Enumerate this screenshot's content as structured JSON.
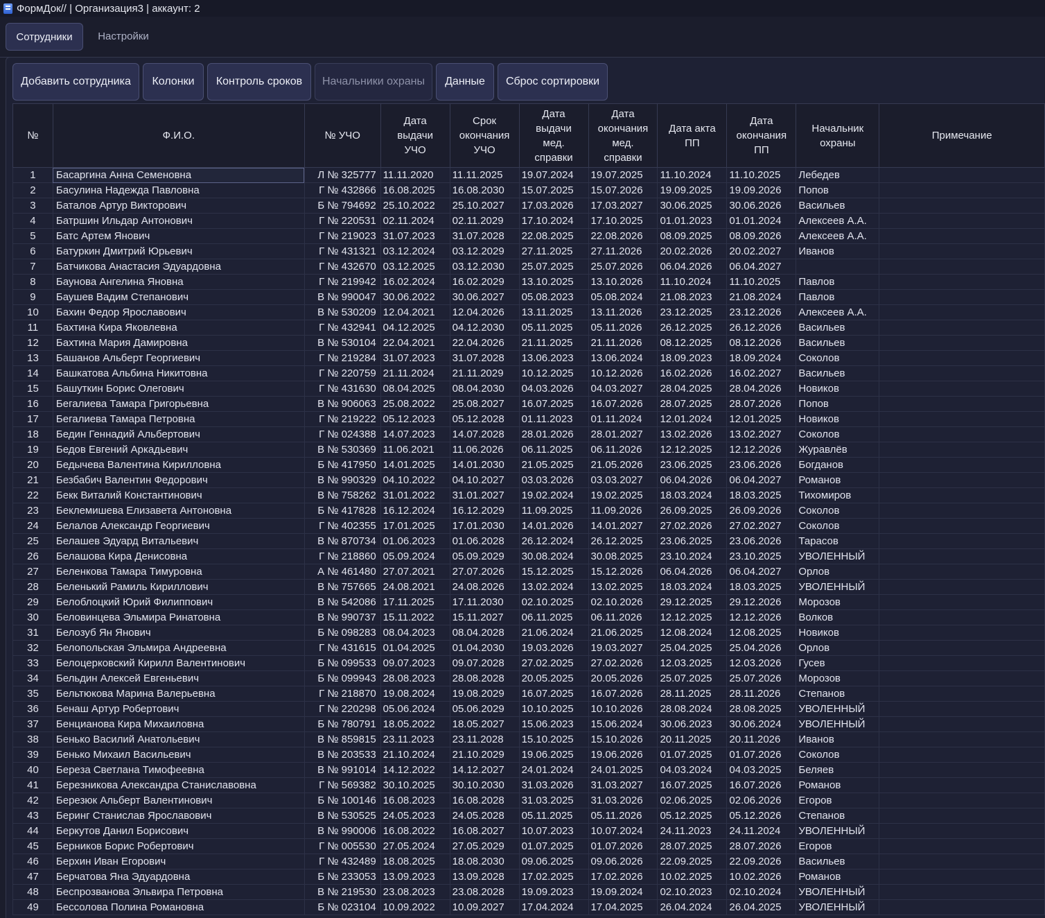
{
  "window": {
    "title": "ФормДок// | Организация3 | аккаунт: 2"
  },
  "tabs": [
    {
      "label": "Сотрудники",
      "active": true
    },
    {
      "label": "Настройки",
      "active": false
    }
  ],
  "toolbar": {
    "add_employee": "Добавить сотрудника",
    "columns": "Колонки",
    "deadline_control": "Контроль сроков",
    "security_chiefs": "Начальники охраны",
    "data": "Данные",
    "reset_sort": "Сброс сортировки"
  },
  "table": {
    "headers": [
      "№",
      "Ф.И.О.",
      "№ УЧО",
      "Дата выдачи УЧО",
      "Срок окончания УЧО",
      "Дата выдачи мед. справки",
      "Дата окончания мед. справки",
      "Дата акта ПП",
      "Дата окончания ПП",
      "Начальник охраны",
      "Примечание"
    ],
    "rows": [
      [
        "1",
        "Басаргина Анна Семеновна",
        "Л № 325777",
        "11.11.2020",
        "11.11.2025",
        "19.07.2024",
        "19.07.2025",
        "11.10.2024",
        "11.10.2025",
        "Лебедев",
        ""
      ],
      [
        "2",
        "Басулина Надежда Павловна",
        "Г № 432866",
        "16.08.2025",
        "16.08.2030",
        "15.07.2025",
        "15.07.2026",
        "19.09.2025",
        "19.09.2026",
        "Попов",
        ""
      ],
      [
        "3",
        "Баталов Артур Викторович",
        "Б № 794692",
        "25.10.2022",
        "25.10.2027",
        "17.03.2026",
        "17.03.2027",
        "30.06.2025",
        "30.06.2026",
        "Васильев",
        ""
      ],
      [
        "4",
        "Батршин Ильдар Антонович",
        "Г № 220531",
        "02.11.2024",
        "02.11.2029",
        "17.10.2024",
        "17.10.2025",
        "01.01.2023",
        "01.01.2024",
        "Алексеев А.А.",
        ""
      ],
      [
        "5",
        "Батс Артем Янович",
        "Г № 219023",
        "31.07.2023",
        "31.07.2028",
        "22.08.2025",
        "22.08.2026",
        "08.09.2025",
        "08.09.2026",
        "Алексеев А.А.",
        ""
      ],
      [
        "6",
        "Батуркин Дмитрий Юрьевич",
        "Г № 431321",
        "03.12.2024",
        "03.12.2029",
        "27.11.2025",
        "27.11.2026",
        "20.02.2026",
        "20.02.2027",
        "Иванов",
        ""
      ],
      [
        "7",
        "Батчикова Анастасия Эдуардовна",
        "Г № 432670",
        "03.12.2025",
        "03.12.2030",
        "25.07.2025",
        "25.07.2026",
        "06.04.2026",
        "06.04.2027",
        "",
        ""
      ],
      [
        "8",
        "Баунова Ангелина Яновна",
        "Г № 219942",
        "16.02.2024",
        "16.02.2029",
        "13.10.2025",
        "13.10.2026",
        "11.10.2024",
        "11.10.2025",
        "Павлов",
        ""
      ],
      [
        "9",
        "Баушев Вадим Степанович",
        "В № 990047",
        "30.06.2022",
        "30.06.2027",
        "05.08.2023",
        "05.08.2024",
        "21.08.2023",
        "21.08.2024",
        "Павлов",
        ""
      ],
      [
        "10",
        "Бахин Федор Ярославович",
        "В № 530209",
        "12.04.2021",
        "12.04.2026",
        "13.11.2025",
        "13.11.2026",
        "23.12.2025",
        "23.12.2026",
        "Алексеев А.А.",
        ""
      ],
      [
        "11",
        "Бахтина Кира Яковлевна",
        "Г № 432941",
        "04.12.2025",
        "04.12.2030",
        "05.11.2025",
        "05.11.2026",
        "26.12.2025",
        "26.12.2026",
        "Васильев",
        ""
      ],
      [
        "12",
        "Бахтина Мария Дамировна",
        "В № 530104",
        "22.04.2021",
        "22.04.2026",
        "21.11.2025",
        "21.11.2026",
        "08.12.2025",
        "08.12.2026",
        "Васильев",
        ""
      ],
      [
        "13",
        "Башанов Альберт Георгиевич",
        "Г № 219284",
        "31.07.2023",
        "31.07.2028",
        "13.06.2023",
        "13.06.2024",
        "18.09.2023",
        "18.09.2024",
        "Соколов",
        ""
      ],
      [
        "14",
        "Башкатова Альбина Никитовна",
        "Г № 220759",
        "21.11.2024",
        "21.11.2029",
        "10.12.2025",
        "10.12.2026",
        "16.02.2026",
        "16.02.2027",
        "Васильев",
        ""
      ],
      [
        "15",
        "Башуткин Борис Олегович",
        "Г № 431630",
        "08.04.2025",
        "08.04.2030",
        "04.03.2026",
        "04.03.2027",
        "28.04.2025",
        "28.04.2026",
        "Новиков",
        ""
      ],
      [
        "16",
        "Бегалиева Тамара Григорьевна",
        "В № 906063",
        "25.08.2022",
        "25.08.2027",
        "16.07.2025",
        "16.07.2026",
        "28.07.2025",
        "28.07.2026",
        "Попов",
        ""
      ],
      [
        "17",
        "Бегалиева Тамара Петровна",
        "Г № 219222",
        "05.12.2023",
        "05.12.2028",
        "01.11.2023",
        "01.11.2024",
        "12.01.2024",
        "12.01.2025",
        "Новиков",
        ""
      ],
      [
        "18",
        "Бедин Геннадий Альбертович",
        "Г № 024388",
        "14.07.2023",
        "14.07.2028",
        "28.01.2026",
        "28.01.2027",
        "13.02.2026",
        "13.02.2027",
        "Соколов",
        ""
      ],
      [
        "19",
        "Бедов Евгений Аркадьевич",
        "В № 530369",
        "11.06.2021",
        "11.06.2026",
        "06.11.2025",
        "06.11.2026",
        "12.12.2025",
        "12.12.2026",
        "Журавлёв",
        ""
      ],
      [
        "20",
        "Бедычева Валентина Кирилловна",
        "Б № 417950",
        "14.01.2025",
        "14.01.2030",
        "21.05.2025",
        "21.05.2026",
        "23.06.2025",
        "23.06.2026",
        "Богданов",
        ""
      ],
      [
        "21",
        "Безбабич Валентин Федорович",
        "В № 990329",
        "04.10.2022",
        "04.10.2027",
        "03.03.2026",
        "03.03.2027",
        "06.04.2026",
        "06.04.2027",
        "Романов",
        ""
      ],
      [
        "22",
        "Бекк Виталий Константинович",
        "В № 758262",
        "31.01.2022",
        "31.01.2027",
        "19.02.2024",
        "19.02.2025",
        "18.03.2024",
        "18.03.2025",
        "Тихомиров",
        ""
      ],
      [
        "23",
        "Беклемишева Елизавета Антоновна",
        "Б № 417828",
        "16.12.2024",
        "16.12.2029",
        "11.09.2025",
        "11.09.2026",
        "26.09.2025",
        "26.09.2026",
        "Соколов",
        ""
      ],
      [
        "24",
        "Белалов Александр Георгиевич",
        "Г № 402355",
        "17.01.2025",
        "17.01.2030",
        "14.01.2026",
        "14.01.2027",
        "27.02.2026",
        "27.02.2027",
        "Соколов",
        ""
      ],
      [
        "25",
        "Белашев Эдуард Витальевич",
        "В № 870734",
        "01.06.2023",
        "01.06.2028",
        "26.12.2024",
        "26.12.2025",
        "23.06.2025",
        "23.06.2026",
        "Тарасов",
        ""
      ],
      [
        "26",
        "Белашова Кира Денисовна",
        "Г № 218860",
        "05.09.2024",
        "05.09.2029",
        "30.08.2024",
        "30.08.2025",
        "23.10.2024",
        "23.10.2025",
        "УВОЛЕННЫЙ",
        ""
      ],
      [
        "27",
        "Беленкова Тамара Тимуровна",
        "А № 461480",
        "27.07.2021",
        "27.07.2026",
        "15.12.2025",
        "15.12.2026",
        "06.04.2026",
        "06.04.2027",
        "Орлов",
        ""
      ],
      [
        "28",
        "Беленький Рамиль Кириллович",
        "В № 757665",
        "24.08.2021",
        "24.08.2026",
        "13.02.2024",
        "13.02.2025",
        "18.03.2024",
        "18.03.2025",
        "УВОЛЕННЫЙ",
        ""
      ],
      [
        "29",
        "Белоблоцкий Юрий Филиппович",
        "В № 542086",
        "17.11.2025",
        "17.11.2030",
        "02.10.2025",
        "02.10.2026",
        "29.12.2025",
        "29.12.2026",
        "Морозов",
        ""
      ],
      [
        "30",
        "Беловинцева Эльмира Ринатовна",
        "В № 990737",
        "15.11.2022",
        "15.11.2027",
        "06.11.2025",
        "06.11.2026",
        "12.12.2025",
        "12.12.2026",
        "Волков",
        ""
      ],
      [
        "31",
        "Белозуб Ян Янович",
        "Б № 098283",
        "08.04.2023",
        "08.04.2028",
        "21.06.2024",
        "21.06.2025",
        "12.08.2024",
        "12.08.2025",
        "Новиков",
        ""
      ],
      [
        "32",
        "Белопольская Эльмира Андреевна",
        "Г № 431615",
        "01.04.2025",
        "01.04.2030",
        "19.03.2026",
        "19.03.2027",
        "25.04.2025",
        "25.04.2026",
        "Орлов",
        ""
      ],
      [
        "33",
        "Белоцерковский Кирилл Валентинович",
        "Б № 099533",
        "09.07.2023",
        "09.07.2028",
        "27.02.2025",
        "27.02.2026",
        "12.03.2025",
        "12.03.2026",
        "Гусев",
        ""
      ],
      [
        "34",
        "Бельдин Алексей Евгеньевич",
        "Б № 099943",
        "28.08.2023",
        "28.08.2028",
        "20.05.2025",
        "20.05.2026",
        "25.07.2025",
        "25.07.2026",
        "Морозов",
        ""
      ],
      [
        "35",
        "Бельтюкова Марина Валерьевна",
        "Г № 218870",
        "19.08.2024",
        "19.08.2029",
        "16.07.2025",
        "16.07.2026",
        "28.11.2025",
        "28.11.2026",
        "Степанов",
        ""
      ],
      [
        "36",
        "Бенаш Артур Робертович",
        "Г № 220298",
        "05.06.2024",
        "05.06.2029",
        "10.10.2025",
        "10.10.2026",
        "28.08.2024",
        "28.08.2025",
        "УВОЛЕННЫЙ",
        ""
      ],
      [
        "37",
        "Бенцианова Кира Михаиловна",
        "Б № 780791",
        "18.05.2022",
        "18.05.2027",
        "15.06.2023",
        "15.06.2024",
        "30.06.2023",
        "30.06.2024",
        "УВОЛЕННЫЙ",
        ""
      ],
      [
        "38",
        "Бенько Василий Анатольевич",
        "В № 859815",
        "23.11.2023",
        "23.11.2028",
        "15.10.2025",
        "15.10.2026",
        "20.11.2025",
        "20.11.2026",
        "Иванов",
        ""
      ],
      [
        "39",
        "Бенько Михаил Васильевич",
        "В № 203533",
        "21.10.2024",
        "21.10.2029",
        "19.06.2025",
        "19.06.2026",
        "01.07.2025",
        "01.07.2026",
        "Соколов",
        ""
      ],
      [
        "40",
        "Береза Светлана Тимофеевна",
        "В № 991014",
        "14.12.2022",
        "14.12.2027",
        "24.01.2024",
        "24.01.2025",
        "04.03.2024",
        "04.03.2025",
        "Беляев",
        ""
      ],
      [
        "41",
        "Березникова Александра Станиславовна",
        "Г № 569382",
        "30.10.2025",
        "30.10.2030",
        "31.03.2026",
        "31.03.2027",
        "16.07.2025",
        "16.07.2026",
        "Романов",
        ""
      ],
      [
        "42",
        "Березюк Альберт Валентинович",
        "Б № 100146",
        "16.08.2023",
        "16.08.2028",
        "31.03.2025",
        "31.03.2026",
        "02.06.2025",
        "02.06.2026",
        "Егоров",
        ""
      ],
      [
        "43",
        "Беринг Станислав Ярославович",
        "В № 530525",
        "24.05.2023",
        "24.05.2028",
        "05.11.2025",
        "05.11.2026",
        "05.12.2025",
        "05.12.2026",
        "Степанов",
        ""
      ],
      [
        "44",
        "Беркутов Данил Борисович",
        "В № 990006",
        "16.08.2022",
        "16.08.2027",
        "10.07.2023",
        "10.07.2024",
        "24.11.2023",
        "24.11.2024",
        "УВОЛЕННЫЙ",
        ""
      ],
      [
        "45",
        "Берников Борис Робертович",
        "Г № 005530",
        "27.05.2024",
        "27.05.2029",
        "01.07.2025",
        "01.07.2026",
        "28.07.2025",
        "28.07.2026",
        "Егоров",
        ""
      ],
      [
        "46",
        "Берхин Иван Егорович",
        "Г № 432489",
        "18.08.2025",
        "18.08.2030",
        "09.06.2025",
        "09.06.2026",
        "22.09.2025",
        "22.09.2026",
        "Васильев",
        ""
      ],
      [
        "47",
        "Берчатова Яна Эдуардовна",
        "Б № 233053",
        "13.09.2023",
        "13.09.2028",
        "17.02.2025",
        "17.02.2026",
        "10.02.2025",
        "10.02.2026",
        "Романов",
        ""
      ],
      [
        "48",
        "Беспрозванова Эльвира Петровна",
        "В № 219530",
        "23.08.2023",
        "23.08.2028",
        "19.09.2023",
        "19.09.2024",
        "02.10.2023",
        "02.10.2024",
        "УВОЛЕННЫЙ",
        ""
      ],
      [
        "49",
        "Бессолова Полина Романовна",
        "Б № 023104",
        "10.09.2022",
        "10.09.2027",
        "17.04.2024",
        "17.04.2025",
        "26.04.2024",
        "26.04.2025",
        "УВОЛЕННЫЙ",
        ""
      ]
    ]
  }
}
